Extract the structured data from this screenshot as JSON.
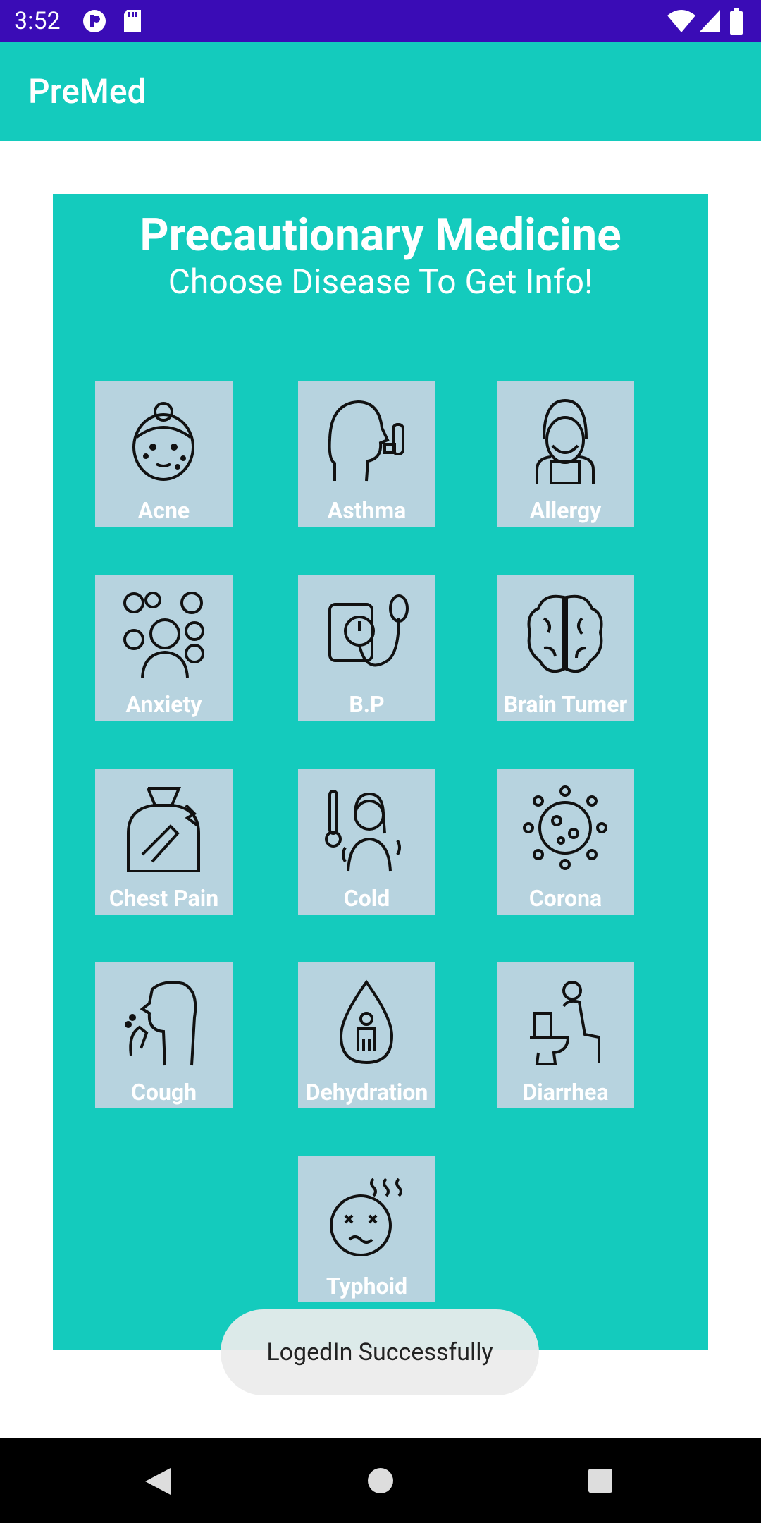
{
  "status_bar": {
    "time": "3:52"
  },
  "app_bar": {
    "title": "PreMed"
  },
  "panel": {
    "heading": "Precautionary Medicine",
    "subheading": "Choose Disease To Get Info!"
  },
  "diseases": [
    {
      "label": "Acne",
      "icon": "acne-icon"
    },
    {
      "label": "Asthma",
      "icon": "asthma-icon"
    },
    {
      "label": "Allergy",
      "icon": "allergy-icon"
    },
    {
      "label": "Anxiety",
      "icon": "anxiety-icon"
    },
    {
      "label": "B.P",
      "icon": "blood-pressure-icon"
    },
    {
      "label": "Brain Tumer",
      "icon": "brain-icon"
    },
    {
      "label": "Chest Pain",
      "icon": "chest-pain-icon"
    },
    {
      "label": "Cold",
      "icon": "cold-icon"
    },
    {
      "label": "Corona",
      "icon": "virus-icon"
    },
    {
      "label": "Cough",
      "icon": "cough-icon"
    },
    {
      "label": "Dehydration",
      "icon": "drop-icon"
    },
    {
      "label": "Diarrhea",
      "icon": "toilet-icon"
    },
    {
      "label": "Typhoid",
      "icon": "fever-face-icon"
    }
  ],
  "toast": {
    "message": "LogedIn Successfully"
  },
  "colors": {
    "accent": "#14cbbd",
    "status_bar": "#3a0cb6",
    "tile": "#b7d3df"
  }
}
